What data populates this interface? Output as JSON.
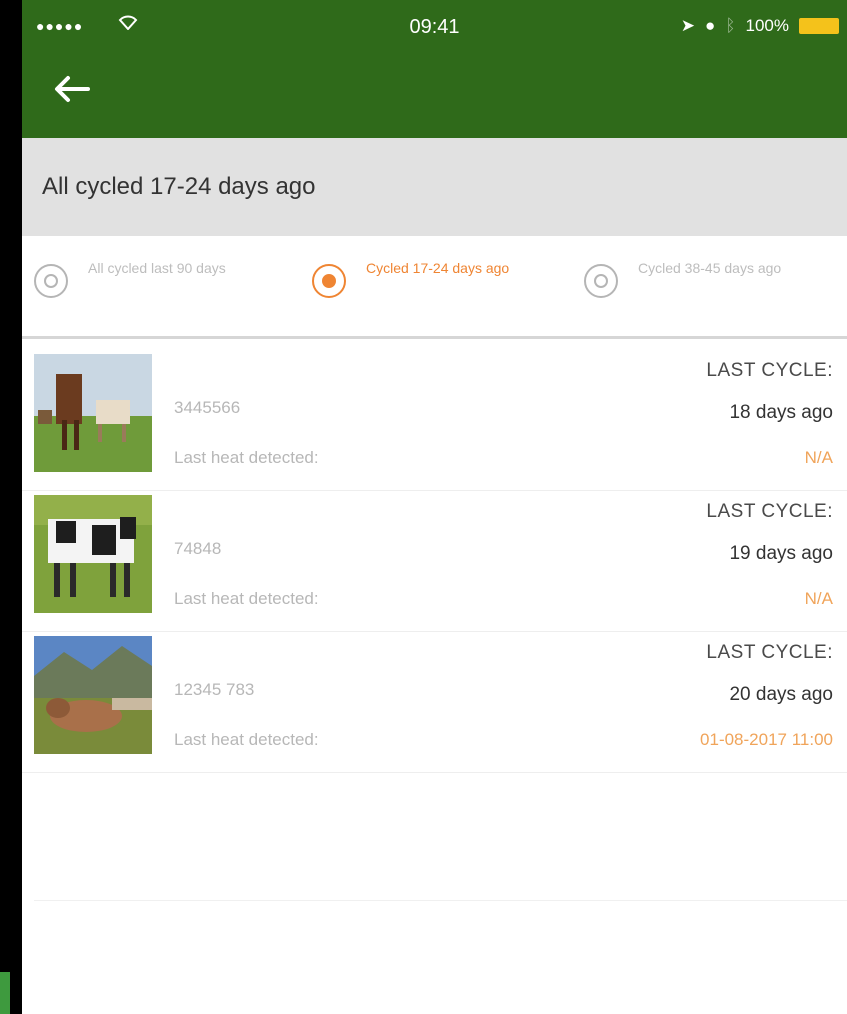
{
  "status": {
    "signal": "●●●●●",
    "time": "09:41",
    "battery": "100%"
  },
  "header": {
    "back_icon": "arrow-left-icon"
  },
  "section": {
    "title": "All cycled 17-24 days ago"
  },
  "filters": [
    {
      "label": "All cycled last 90 days",
      "active": false
    },
    {
      "label": "Cycled 17-24 days ago",
      "active": true
    },
    {
      "label": "Cycled 38-45 days ago",
      "active": false
    }
  ],
  "rows": [
    {
      "tag": "3445566",
      "heat_label": "Last heat detected:",
      "cycle_label": "LAST CYCLE:",
      "cycle_value": "18 days ago",
      "heat_value": "N/A"
    },
    {
      "tag": "74848",
      "heat_label": "Last heat detected:",
      "cycle_label": "LAST CYCLE:",
      "cycle_value": "19 days ago",
      "heat_value": "N/A"
    },
    {
      "tag": "12345 783",
      "heat_label": "Last heat detected:",
      "cycle_label": "LAST CYCLE:",
      "cycle_value": "20 days ago",
      "heat_value": "01-08-2017 11:00"
    }
  ],
  "colors": {
    "header": "#2f6a1a",
    "accent": "#ef8533",
    "section_bg": "#e1e1e1"
  }
}
